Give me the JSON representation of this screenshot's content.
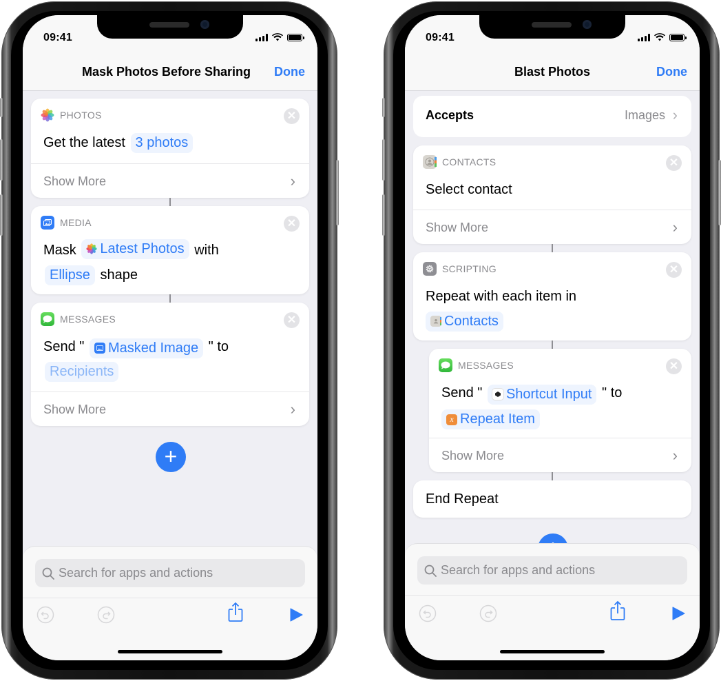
{
  "status_bar": {
    "time": "09:41"
  },
  "left": {
    "nav": {
      "title": "Mask Photos Before Sharing",
      "done": "Done"
    },
    "actions": [
      {
        "category": "PHOTOS",
        "icon": "photos-icon",
        "text_parts": [
          "Get the latest"
        ],
        "pill": "3 photos",
        "show_more": "Show More"
      },
      {
        "category": "MEDIA",
        "icon": "media-icon",
        "text_mask": "Mask",
        "pill_input": "Latest Photos",
        "text_with": "with",
        "pill_shape": "Ellipse",
        "text_shape": "shape"
      },
      {
        "category": "MESSAGES",
        "icon": "messages-icon",
        "text_send": "Send \"",
        "pill_msg": "Masked Image",
        "text_to": "\" to",
        "pill_recipients": "Recipients",
        "show_more": "Show More"
      }
    ],
    "add_label": "+",
    "search_placeholder": "Search for apps and actions"
  },
  "right": {
    "nav": {
      "title": "Blast Photos",
      "done": "Done"
    },
    "accepts": {
      "label": "Accepts",
      "value": "Images"
    },
    "actions": [
      {
        "category": "CONTACTS",
        "icon": "contacts-icon",
        "text": "Select contact",
        "show_more": "Show More"
      },
      {
        "category": "SCRIPTING",
        "icon": "scripting-gear-icon",
        "text": "Repeat with each item in",
        "pill": "Contacts"
      },
      {
        "category": "MESSAGES",
        "icon": "messages-icon",
        "text_send": "Send \"",
        "pill_msg": "Shortcut Input",
        "text_to": "\" to",
        "pill_recipients": "Repeat Item",
        "show_more": "Show More"
      },
      {
        "text": "End Repeat"
      }
    ],
    "search_placeholder": "Search for apps and actions"
  },
  "colors": {
    "accent": "#2f7cf6",
    "background": "#efeff4",
    "category_text": "#8a8a8e"
  }
}
